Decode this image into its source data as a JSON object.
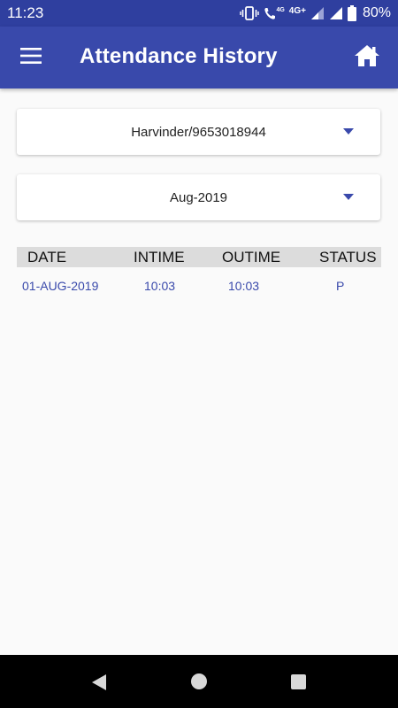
{
  "status_bar": {
    "time": "11:23",
    "battery": "80%",
    "network_small": "4G",
    "network": "4G+",
    "icons": [
      "vibrate-icon",
      "wifi-call-icon",
      "signal-icon",
      "signal-icon",
      "battery-icon"
    ]
  },
  "app_bar": {
    "title": "Attendance History",
    "menu_icon": "hamburger-menu-icon",
    "home_icon": "home-icon",
    "color": "#3949ab"
  },
  "filters": {
    "user": "Harvinder/9653018944",
    "month": "Aug-2019"
  },
  "table": {
    "headers": [
      "DATE",
      "INTIME",
      "OUTIME",
      "STATUS"
    ],
    "rows": [
      [
        "01-AUG-2019",
        "10:03",
        "10:03",
        "P"
      ]
    ]
  },
  "nav_bar": {
    "icons": [
      "back-icon",
      "home-circle-icon",
      "recents-icon"
    ]
  }
}
